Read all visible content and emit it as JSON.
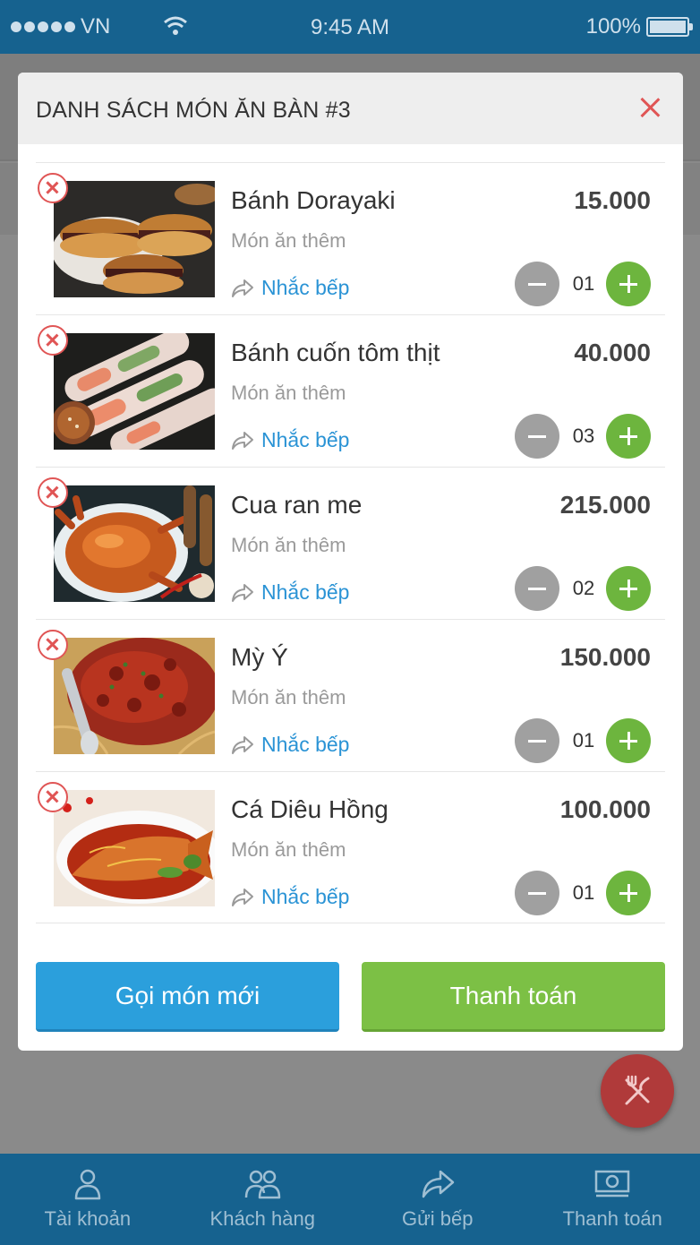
{
  "status_bar": {
    "carrier": "VN",
    "time": "9:45 AM",
    "battery": "100%"
  },
  "modal": {
    "title": "DANH SÁCH MÓN ĂN BÀN #3",
    "items": [
      {
        "name": "Bánh Dorayaki",
        "price": "15.000",
        "note": "Món ăn thêm",
        "remind": "Nhắc bếp",
        "qty": "01",
        "image": "dorayaki"
      },
      {
        "name": "Bánh cuốn tôm thịt",
        "price": "40.000",
        "note": "Món ăn thêm",
        "remind": "Nhắc bếp",
        "qty": "03",
        "image": "spring-rolls"
      },
      {
        "name": "Cua ran me",
        "price": "215.000",
        "note": "Món ăn thêm",
        "remind": "Nhắc bếp",
        "qty": "02",
        "image": "tamarind-crab"
      },
      {
        "name": "Mỳ Ý",
        "price": "150.000",
        "note": "Món ăn thêm",
        "remind": "Nhắc bếp",
        "qty": "01",
        "image": "spaghetti"
      },
      {
        "name": "Cá Diêu Hồng",
        "price": "100.000",
        "note": "Món ăn thêm",
        "remind": "Nhắc bếp",
        "qty": "01",
        "image": "red-tilapia"
      }
    ],
    "order_button": "Gọi món mới",
    "pay_button": "Thanh toán"
  },
  "bottom_nav": [
    {
      "label": "Tài khoản",
      "icon": "user-icon"
    },
    {
      "label": "Khách hàng",
      "icon": "users-icon"
    },
    {
      "label": "Gửi bếp",
      "icon": "share-icon"
    },
    {
      "label": "Thanh toán",
      "icon": "money-icon"
    }
  ],
  "colors": {
    "primary": "#16628f",
    "blue_button": "#2b9fdc",
    "green_button": "#7cc045",
    "remove": "#e05555",
    "fab": "#b03a3a"
  }
}
